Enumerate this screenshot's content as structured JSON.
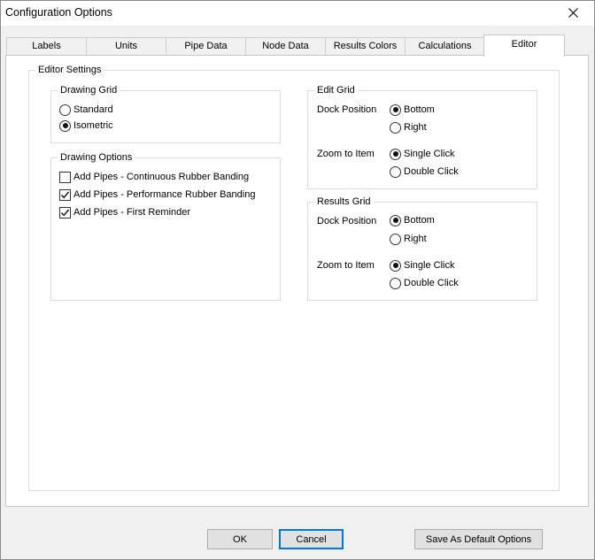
{
  "window": {
    "title": "Configuration Options"
  },
  "tabs": [
    {
      "label": "Labels",
      "active": false
    },
    {
      "label": "Units",
      "active": false
    },
    {
      "label": "Pipe Data",
      "active": false
    },
    {
      "label": "Node Data",
      "active": false
    },
    {
      "label": "Results Colors",
      "active": false
    },
    {
      "label": "Calculations",
      "active": false
    },
    {
      "label": "Editor",
      "active": true
    }
  ],
  "editor_settings": {
    "label": "Editor Settings",
    "drawing_grid": {
      "label": "Drawing Grid",
      "options": [
        {
          "label": "Standard",
          "selected": false
        },
        {
          "label": "Isometric",
          "selected": true
        }
      ]
    },
    "drawing_options": {
      "label": "Drawing Options",
      "items": [
        {
          "label": "Add Pipes - Continuous Rubber Banding",
          "checked": false
        },
        {
          "label": "Add Pipes - Performance Rubber Banding",
          "checked": true
        },
        {
          "label": "Add Pipes - First Reminder",
          "checked": true
        }
      ]
    },
    "edit_grid": {
      "label": "Edit Grid",
      "dock_position": {
        "label": "Dock Position",
        "options": [
          {
            "label": "Bottom",
            "selected": true
          },
          {
            "label": "Right",
            "selected": false
          }
        ]
      },
      "zoom_to_item": {
        "label": "Zoom to Item",
        "options": [
          {
            "label": "Single Click",
            "selected": true
          },
          {
            "label": "Double Click",
            "selected": false
          }
        ]
      }
    },
    "results_grid": {
      "label": "Results Grid",
      "dock_position": {
        "label": "Dock Position",
        "options": [
          {
            "label": "Bottom",
            "selected": true
          },
          {
            "label": "Right",
            "selected": false
          }
        ]
      },
      "zoom_to_item": {
        "label": "Zoom to Item",
        "options": [
          {
            "label": "Single Click",
            "selected": true
          },
          {
            "label": "Double Click",
            "selected": false
          }
        ]
      }
    }
  },
  "buttons": {
    "ok": "OK",
    "cancel": "Cancel",
    "save_default": "Save As Default Options"
  },
  "colors": {
    "focus": "#0078d7",
    "panel": "#ffffff",
    "dialog": "#f0f0f0"
  }
}
